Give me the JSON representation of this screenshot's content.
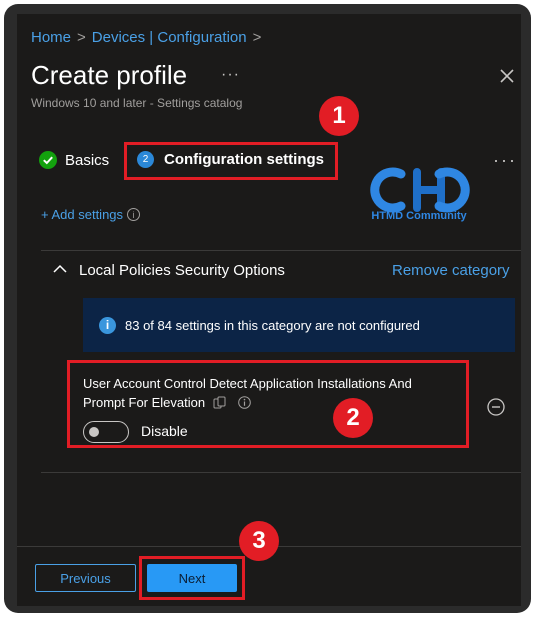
{
  "breadcrumb": [
    {
      "label": "Home"
    },
    {
      "label": "Devices | Configuration"
    }
  ],
  "header": {
    "title": "Create profile",
    "more": "···",
    "subtitle": "Windows 10 and later - Settings catalog"
  },
  "tabs": [
    {
      "label": "Basics",
      "state": "completed"
    },
    {
      "label": "Configuration settings",
      "step": "2",
      "state": "active"
    }
  ],
  "tab_more": "···",
  "add_settings": "+ Add settings",
  "watermark": {
    "text": "HTMD Community"
  },
  "category": {
    "title": "Local Policies Security Options",
    "remove_label": "Remove category",
    "info": "83 of 84 settings in this category are not configured"
  },
  "setting": {
    "name_line1": "User Account Control Detect Application Installations And",
    "name_line2": "Prompt For Elevation",
    "toggle_state": "Disable"
  },
  "footer": {
    "previous_label": "Previous",
    "next_label": "Next"
  },
  "annotations": [
    "1",
    "2",
    "3"
  ],
  "colors": {
    "accent": "#4aa0e6",
    "primary_button": "#2899f5",
    "info_bar": "#0c2446",
    "success": "#13a10e",
    "annotation": "#e21d25",
    "background": "#1b1a19"
  }
}
